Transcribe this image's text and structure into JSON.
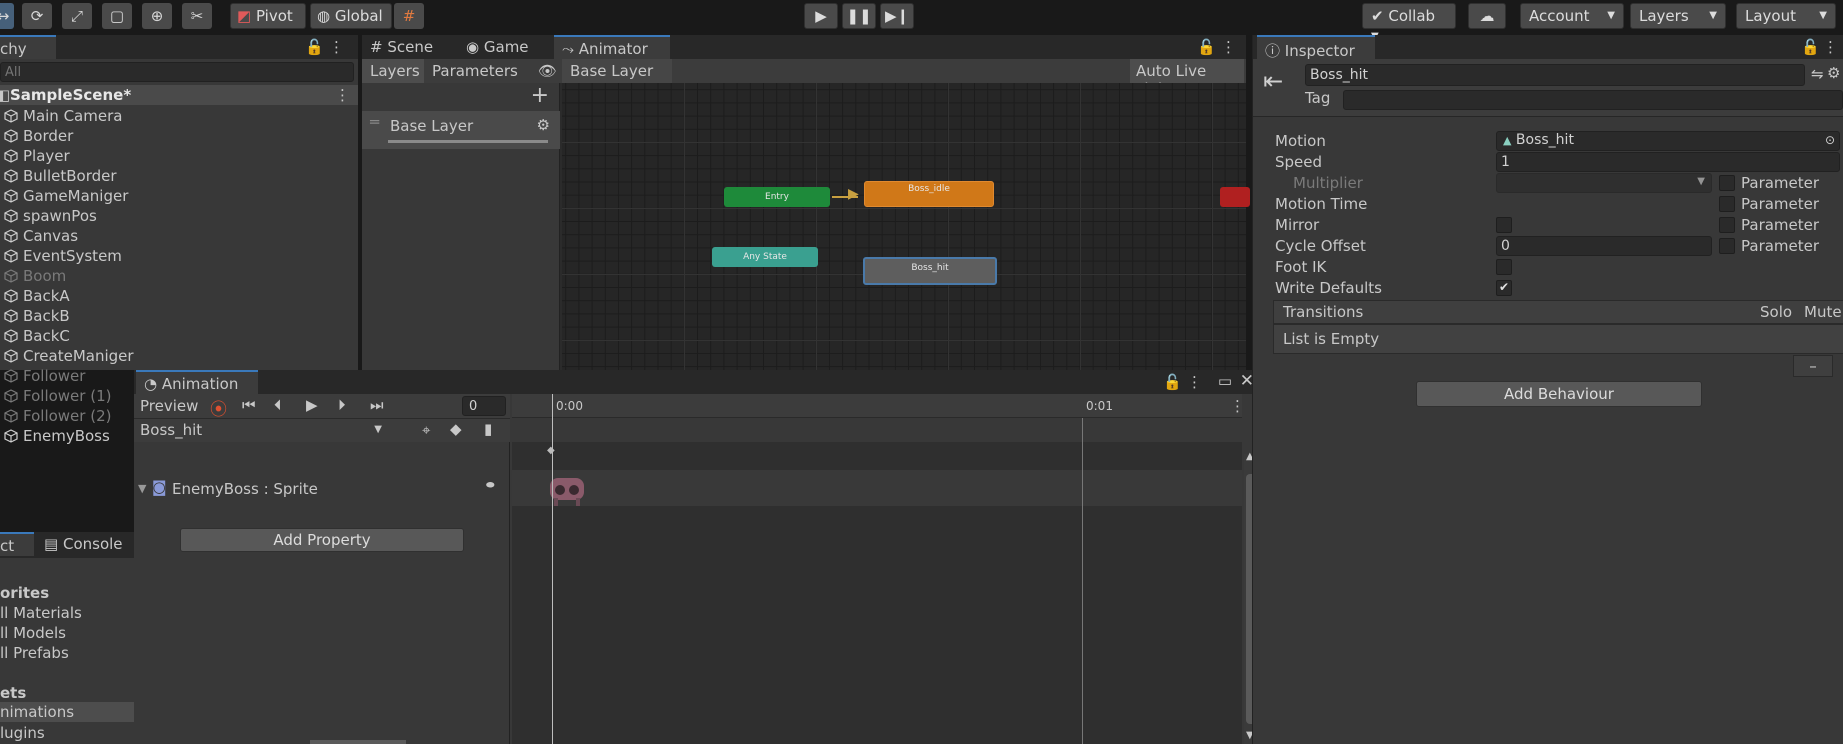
{
  "toolbar": {
    "pivot_label": "Pivot",
    "global_label": "Global",
    "collab_label": "Collab",
    "account_label": "Account",
    "layers_label": "Layers",
    "layout_label": "Layout"
  },
  "hierarchy": {
    "tab_label": "chy",
    "search_placeholder": "All",
    "scene_name": "SampleScene*",
    "items": [
      {
        "label": "Main Camera",
        "active": true
      },
      {
        "label": "Border",
        "active": true
      },
      {
        "label": "Player",
        "active": true
      },
      {
        "label": "BulletBorder",
        "active": true
      },
      {
        "label": "GameManiger",
        "active": true
      },
      {
        "label": "spawnPos",
        "active": true
      },
      {
        "label": "Canvas",
        "active": true
      },
      {
        "label": "EventSystem",
        "active": true
      },
      {
        "label": "Boom",
        "active": false
      },
      {
        "label": "BackA",
        "active": true
      },
      {
        "label": "BackB",
        "active": true
      },
      {
        "label": "BackC",
        "active": true
      },
      {
        "label": "CreateManiger",
        "active": true
      },
      {
        "label": "Follower",
        "active": false
      },
      {
        "label": "Follower (1)",
        "active": false
      },
      {
        "label": "Follower (2)",
        "active": false
      },
      {
        "label": "EnemyBoss",
        "active": true
      }
    ]
  },
  "project": {
    "tab_project": "ct",
    "tab_console": "Console",
    "favorites_label": "orites",
    "fav_items": [
      "ll Materials",
      "ll Models",
      "ll Prefabs"
    ],
    "assets_label": "ets",
    "asset_items": [
      "nimations",
      "lugins"
    ]
  },
  "animator": {
    "tab_scene": "Scene",
    "tab_game": "Game",
    "tab_animator": "Animator",
    "layers_btn": "Layers",
    "parameters_btn": "Parameters",
    "breadcrumb": "Base Layer",
    "auto_live_link": "Auto Live Link",
    "layer_name": "Base Layer",
    "nodes": {
      "entry": "Entry",
      "idle": "Boss_idle",
      "any": "Any State",
      "hit": "Boss_hit"
    }
  },
  "animation": {
    "tab_label": "Animation",
    "preview_label": "Preview",
    "frame_value": "0",
    "clip_name": "Boss_hit",
    "property_name": "EnemyBoss : Sprite",
    "add_property": "Add Property",
    "time_start": "0:00",
    "time_end": "0:01"
  },
  "inspector": {
    "tab_label": "Inspector",
    "object_name": "Boss_hit",
    "tag_label": "Tag",
    "motion_label": "Motion",
    "motion_value": "Boss_hit",
    "speed_label": "Speed",
    "speed_value": "1",
    "multiplier_label": "Multiplier",
    "motion_time_label": "Motion Time",
    "mirror_label": "Mirror",
    "cycle_offset_label": "Cycle Offset",
    "cycle_offset_value": "0",
    "foot_ik_label": "Foot IK",
    "write_defaults_label": "Write Defaults",
    "write_defaults_checked": true,
    "parameter_label": "Parameter",
    "transitions_label": "Transitions",
    "solo_label": "Solo",
    "mute_label": "Mute",
    "list_empty": "List is Empty",
    "remove_label": "–",
    "add_behaviour": "Add Behaviour"
  },
  "colors": {
    "accent": "#3a79bb",
    "entry_node": "#1e8a3a",
    "idle_node": "#d07818",
    "any_node": "#3aa090",
    "hit_node": "#5e5e5e",
    "record": "#e05030"
  }
}
